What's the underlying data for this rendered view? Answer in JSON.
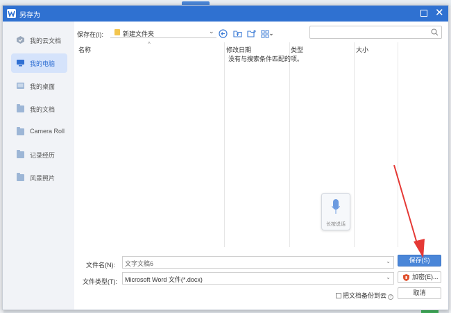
{
  "dialog": {
    "title": "另存为"
  },
  "sidebar": {
    "items": [
      {
        "label": "我的云文档",
        "icon": "cloud-docs-icon"
      },
      {
        "label": "我的电脑",
        "icon": "computer-icon",
        "active": true
      },
      {
        "label": "我的桌面",
        "icon": "desktop-icon"
      },
      {
        "label": "我的文档",
        "icon": "folder-icon"
      },
      {
        "label": "Camera Roll",
        "icon": "folder-icon"
      },
      {
        "label": "记录经历",
        "icon": "folder-icon"
      },
      {
        "label": "风景照片",
        "icon": "folder-icon"
      }
    ]
  },
  "toolbar": {
    "save_in_label": "保存在(I):",
    "current_folder": "新建文件夹",
    "search_placeholder": ""
  },
  "filelist": {
    "columns": [
      "名称",
      "修改日期",
      "类型",
      "大小"
    ],
    "empty_message": "没有与搜索条件匹配的项。"
  },
  "voice_input": {
    "label": "长按说话"
  },
  "form": {
    "filename_label": "文件名(N):",
    "filename_value": "文字文稿6",
    "filetype_label": "文件类型(T):",
    "filetype_value": "Microsoft Word 文件(*.docx)",
    "backup_label": "把文档备份到云"
  },
  "buttons": {
    "save": "保存(S)",
    "encrypt": "加密(E)...",
    "cancel": "取消"
  },
  "colors": {
    "accent": "#2f71d1",
    "annotation_arrow": "#e53935"
  }
}
